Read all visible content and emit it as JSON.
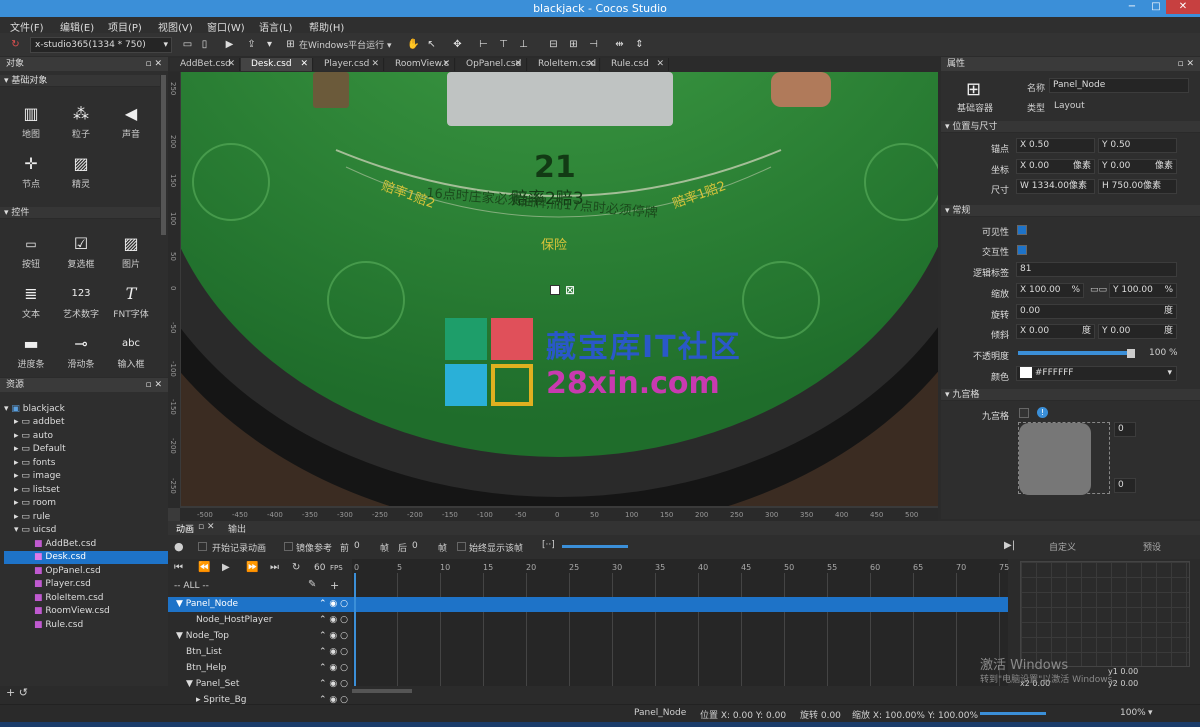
{
  "window": {
    "title": "blackjack - Cocos Studio",
    "minimize": "−",
    "maximize": "□",
    "close": "✕"
  },
  "menu": [
    "文件(F)",
    "编辑(E)",
    "项目(P)",
    "视图(V)",
    "窗口(W)",
    "语言(L)",
    "帮助(H)"
  ],
  "toolbar": {
    "resolution": "x-studio365(1334 * 750)",
    "run_target": "在Windows平台运行"
  },
  "objects_panel": {
    "title": "对象",
    "sections": [
      {
        "title": "基础对象",
        "items": [
          {
            "label": "地图",
            "icon": "map-icon",
            "glyph": "▥"
          },
          {
            "label": "粒子",
            "icon": "particle-icon",
            "glyph": "⁂"
          },
          {
            "label": "声音",
            "icon": "sound-icon",
            "glyph": "◀"
          },
          {
            "label": "节点",
            "icon": "node-icon",
            "glyph": "✛"
          },
          {
            "label": "精灵",
            "icon": "sprite-icon",
            "glyph": "▨"
          }
        ]
      },
      {
        "title": "控件",
        "items": [
          {
            "label": "按钮",
            "icon": "button-icon",
            "glyph": "▭"
          },
          {
            "label": "复选框",
            "icon": "checkbox-icon",
            "glyph": "☑"
          },
          {
            "label": "图片",
            "icon": "image-icon",
            "glyph": "▨"
          },
          {
            "label": "文本",
            "icon": "text-icon",
            "glyph": "≣"
          },
          {
            "label": "艺术数字",
            "icon": "art-number-icon",
            "glyph": "123"
          },
          {
            "label": "FNT字体",
            "icon": "fnt-font-icon",
            "glyph": "T"
          },
          {
            "label": "进度条",
            "icon": "progress-bar-icon",
            "glyph": "▬"
          },
          {
            "label": "滑动条",
            "icon": "slider-icon",
            "glyph": "⊸"
          },
          {
            "label": "输入框",
            "icon": "input-box-icon",
            "glyph": "abc"
          }
        ]
      }
    ]
  },
  "resources_panel": {
    "title": "资源",
    "root": "blackjack",
    "folders": [
      "addbet",
      "auto",
      "Default",
      "fonts",
      "image",
      "listset",
      "room",
      "rule",
      "uicsd"
    ],
    "files": [
      "AddBet.csd",
      "Desk.csd",
      "OpPanel.csd",
      "Player.csd",
      "RoleItem.csd",
      "RoomView.csd",
      "Rule.csd"
    ],
    "selected_file": "Desk.csd"
  },
  "tabs": [
    "AddBet.csd",
    "Desk.csd",
    "Player.csd",
    "RoomView.c",
    "OpPanel.csd",
    "RoleItem.csd",
    "Rule.csd"
  ],
  "active_tab": "Desk.csd",
  "canvas": {
    "big_number": "21",
    "payout_main": "赔率2赔3",
    "rule_text": "16点时庄家必须抽牌,而17点时必须停牌",
    "left_label": "赔率1赔2",
    "right_label": "赔率1赔2",
    "insurance": "保险",
    "watermark_cn": "藏宝库IT社区",
    "watermark_url": "28xin.com",
    "x_ruler": [
      "-500",
      "-450",
      "-400",
      "-350",
      "-300",
      "-250",
      "-200",
      "-150",
      "-100",
      "-50",
      "0",
      "50",
      "100",
      "150",
      "200",
      "250",
      "300",
      "350",
      "400",
      "450",
      "500"
    ],
    "y_ruler": [
      "250",
      "200",
      "150",
      "100",
      "50",
      "0",
      "-50",
      "-100",
      "-150",
      "-200",
      "-250"
    ]
  },
  "properties": {
    "title": "属性",
    "container_label": "基础容器",
    "name_label": "名称",
    "name_value": "Panel_Node",
    "type_label": "类型",
    "type_value": "Layout",
    "pos_section": "位置与尺寸",
    "anchor_label": "锚点",
    "anchor_x": "0.50",
    "anchor_y": "0.50",
    "coord_label": "坐标",
    "coord_x": "0.00",
    "coord_y": "0.00",
    "coord_unit": "像素",
    "size_label": "尺寸",
    "size_w": "1334.00",
    "size_h": "750.00",
    "size_unit": "像素",
    "general_section": "常规",
    "visible_label": "可见性",
    "interactive_label": "交互性",
    "tag_label": "逻辑标签",
    "tag_value": "81",
    "scale_label": "缩放",
    "scale_x": "100.00",
    "scale_y": "100.00",
    "pct": "%",
    "rotation_label": "旋转",
    "rotation_value": "0.00",
    "deg": "度",
    "skew_label": "倾斜",
    "skew_x": "0.00",
    "skew_y": "0.00",
    "opacity_label": "不透明度",
    "opacity_value": "100",
    "opacity_fraction": 1.0,
    "color_label": "颜色",
    "color_value": "#FFFFFF",
    "nine_section": "九宫格",
    "nine_label": "九宫格",
    "nine_top": "0",
    "nine_bottom": "0"
  },
  "timeline": {
    "anim_tab": "动画",
    "output_tab": "输出",
    "record_label": "开始记录动画",
    "mirror_label": "镜像参考",
    "front_label": "前",
    "front_value": "0",
    "frame_label": "帧",
    "back_label": "后",
    "back_value": "0",
    "always_show_label": "始终显示该帧",
    "fps_value": "60",
    "fps_label": "FPS",
    "filter": "-- ALL --",
    "custom_label": "自定义",
    "preset_label": "预设",
    "ticks": [
      "0",
      "5",
      "10",
      "15",
      "20",
      "25",
      "30",
      "35",
      "40",
      "45",
      "50",
      "55",
      "60",
      "65",
      "70",
      "75"
    ],
    "nodes": [
      {
        "label": "Panel_Node",
        "indent": 0,
        "expand": "▼",
        "selected": true
      },
      {
        "label": "Node_HostPlayer",
        "indent": 2,
        "expand": "",
        "selected": false
      },
      {
        "label": "Node_Top",
        "indent": 0,
        "expand": "▼",
        "selected": false
      },
      {
        "label": "Btn_List",
        "indent": 1,
        "expand": "",
        "selected": false
      },
      {
        "label": "Btn_Help",
        "indent": 1,
        "expand": "",
        "selected": false
      },
      {
        "label": "Panel_Set",
        "indent": 1,
        "expand": "▼",
        "selected": false
      },
      {
        "label": "Sprite_Bg",
        "indent": 2,
        "expand": "▸",
        "selected": false
      }
    ],
    "curve": {
      "x1": "0.00",
      "y1": "0.00",
      "x2": "0.00",
      "y2": "0.00"
    },
    "windows_activate": "激活 Windows",
    "windows_activate_sub": "转到\"电脑设置\"以激活 Windows。"
  },
  "statusbar": {
    "node": "Panel_Node",
    "position": "位置 X: 0.00   Y: 0.00",
    "rotation": "旋转 0.00",
    "scale": "缩放 X: 100.00%   Y: 100.00%",
    "zoom": "100%"
  }
}
